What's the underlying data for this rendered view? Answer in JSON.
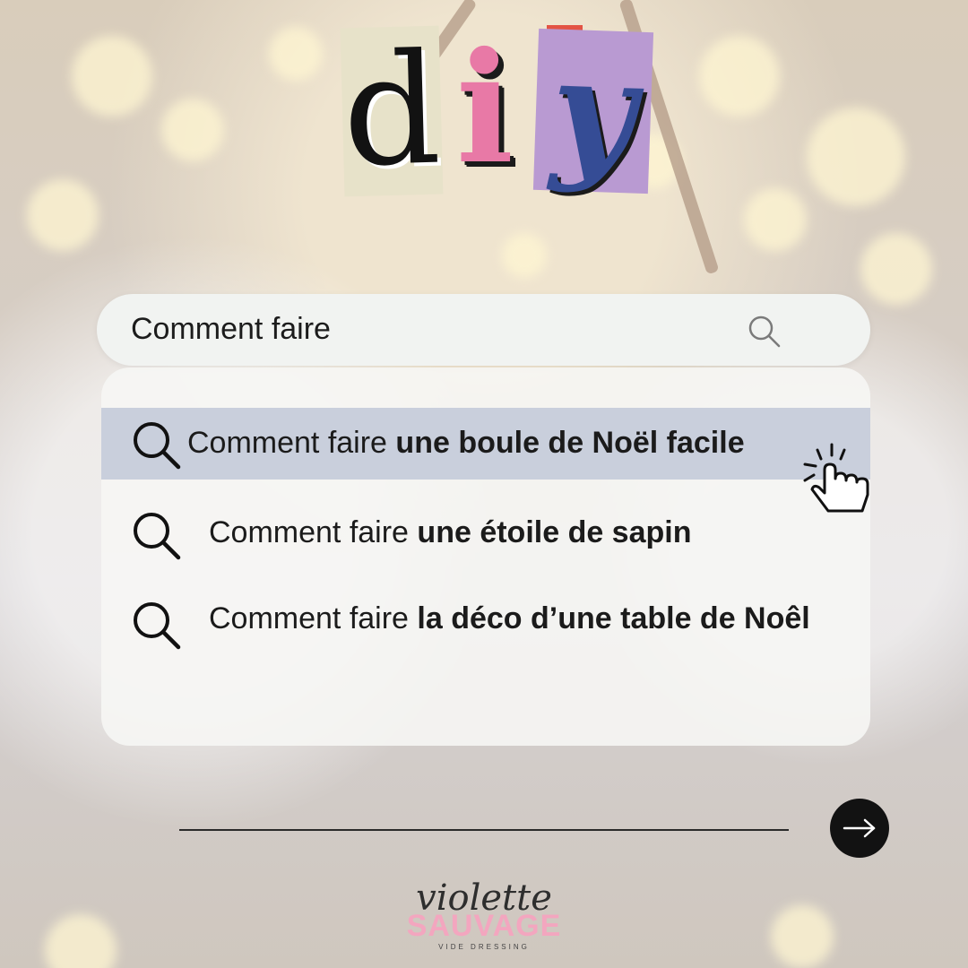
{
  "logo": {
    "letters": [
      "d",
      "i",
      "y"
    ]
  },
  "search": {
    "query": "Comment faire",
    "icon": "search-icon"
  },
  "suggestions": [
    {
      "prefix": "Comment faire",
      "bold": "une boule de Noël facile",
      "highlighted": true
    },
    {
      "prefix": "Comment faire",
      "bold": "une étoile de sapin",
      "highlighted": false
    },
    {
      "prefix": "Comment faire",
      "bold": "la déco d’une table de Noêl",
      "highlighted": false
    }
  ],
  "footer": {
    "next_icon": "arrow-right-icon",
    "brand_script": "violette",
    "brand_name": "SAUVAGE",
    "brand_tagline": "VIDE DRESSING"
  },
  "colors": {
    "highlight": "#c9cfdc",
    "brand_pink": "#f3a6bf",
    "diy_pink": "#e879a6",
    "diy_blue": "#354c95",
    "diy_purple": "#b99ad2"
  }
}
